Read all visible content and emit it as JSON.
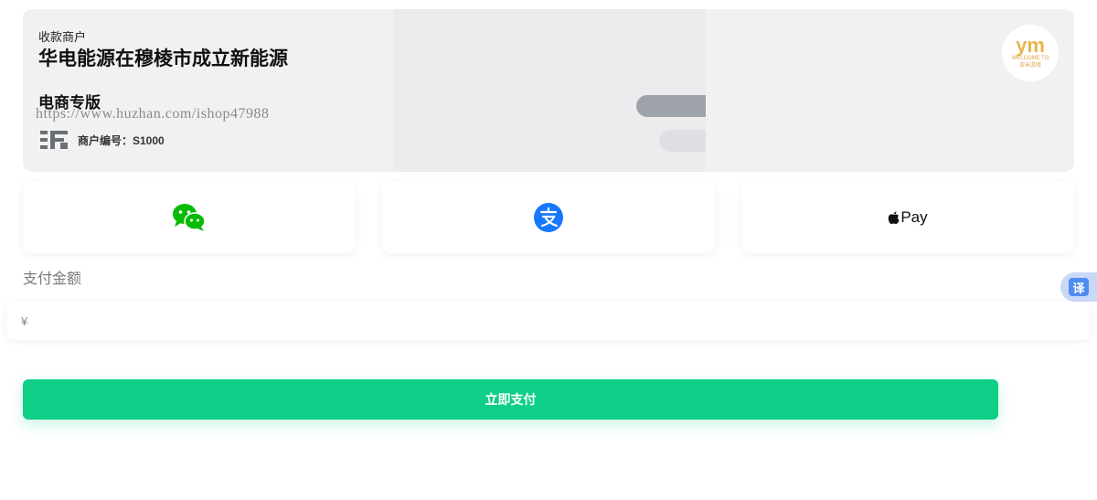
{
  "merchant": {
    "label": "收款商户",
    "name": "华电能源在穆棱市成立新能源",
    "edition": "电商专版",
    "watermark": "https://www.huzhan.com/ishop47988",
    "id_text": "商户编号：S1000"
  },
  "logo": {
    "mark": "ym",
    "line1": "WELCOME TO",
    "line2": "亚米游戏"
  },
  "payment_methods": [
    {
      "icon": "wechat-icon",
      "color": "#09bb07"
    },
    {
      "icon": "alipay-icon",
      "color": "#1677ff"
    },
    {
      "label": "Pay",
      "icon": "apple-icon"
    }
  ],
  "amount": {
    "label": "支付金额",
    "currency": "¥",
    "value": ""
  },
  "translate": {
    "label": "译"
  },
  "submit": {
    "label": "立即支付",
    "color": "#0fcf88"
  }
}
